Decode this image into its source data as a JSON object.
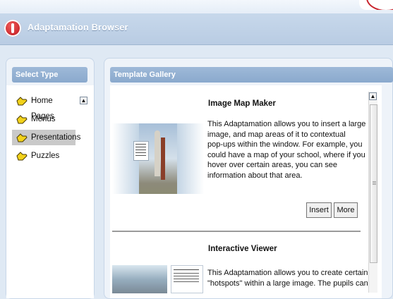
{
  "app": {
    "title": "Adaptamation Browser"
  },
  "select_type": {
    "header": "Select Type",
    "items": [
      {
        "label": "Home Pages",
        "selected": false,
        "icon": "folder-icon"
      },
      {
        "label": "Menus",
        "selected": false,
        "icon": "folder-icon"
      },
      {
        "label": "Presentations",
        "selected": true,
        "icon": "folder-icon"
      },
      {
        "label": "Puzzles",
        "selected": false,
        "icon": "folder-icon"
      }
    ]
  },
  "gallery": {
    "header": "Template Gallery",
    "entries": [
      {
        "title": "Image Map Maker",
        "desc_lines": [
          "This Adaptamation allows you to insert a large",
          "image, and map areas of it to contextual",
          "pop-ups within the window. For example, you",
          "could have a map of your school, where if you",
          "hover over certain areas, you can see",
          "information about that area."
        ],
        "insert_label": "Insert",
        "more_label": "More"
      },
      {
        "title": "Interactive Viewer",
        "desc_lines": [
          "This Adaptamation allows you to create certain",
          "\"hotspots\" within a large image. The pupils can"
        ]
      }
    ]
  },
  "colors": {
    "header_blue": "#8aa9cd",
    "titlebar_blue": "#c7d8eb",
    "brand_red": "#c9232c",
    "selected_grey": "#c9c9c9"
  }
}
